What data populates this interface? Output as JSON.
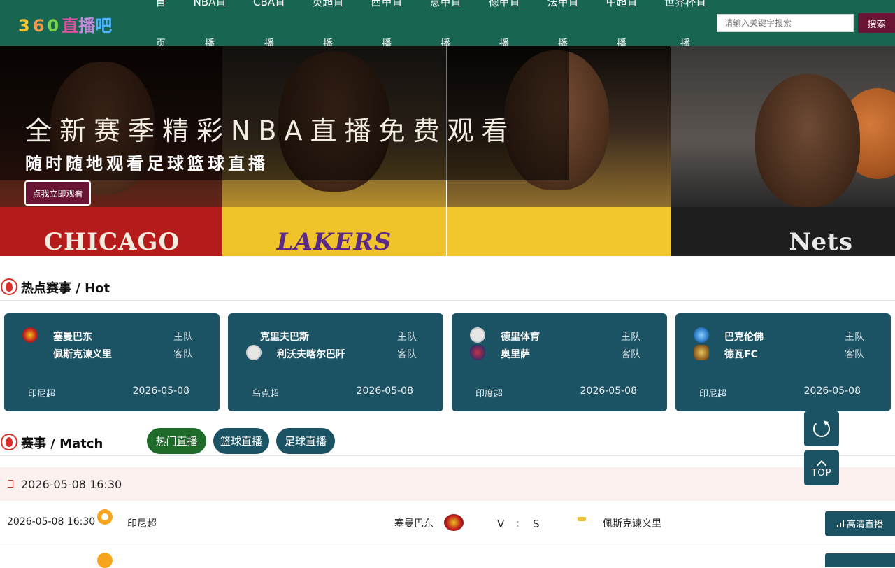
{
  "logo": {
    "text": "360 直播吧",
    "chars": [
      "3",
      "6",
      "0",
      "直",
      "播",
      "吧"
    ]
  },
  "nav": [
    {
      "top": "首",
      "bottom": "页"
    },
    {
      "top": "NBA直",
      "bottom": "播"
    },
    {
      "top": "CBA直",
      "bottom": "播"
    },
    {
      "top": "英超直",
      "bottom": "播"
    },
    {
      "top": "西甲直",
      "bottom": "播"
    },
    {
      "top": "意甲直",
      "bottom": "播"
    },
    {
      "top": "德甲直",
      "bottom": "播"
    },
    {
      "top": "法甲直",
      "bottom": "播"
    },
    {
      "top": "中超直",
      "bottom": "播"
    },
    {
      "top": "世界杯直",
      "bottom": "播"
    }
  ],
  "search": {
    "placeholder": "请输入关键字搜索",
    "button": "搜索"
  },
  "banner": {
    "title": "全新赛季精彩NBA直播免费观看",
    "subtitle": "随时随地观看足球篮球直播",
    "cta": "点我立即观看",
    "jersey_texts": [
      "CHICAGO",
      "LAKERS",
      "",
      "Nets"
    ]
  },
  "hot": {
    "title": "热点赛事 / Hot",
    "cards": [
      {
        "home": "塞曼巴东",
        "away": "佩斯克谏义里",
        "home_role": "主队",
        "away_role": "客队",
        "league": "印尼超",
        "date": "2026-05-08",
        "logo1_color": "#c21c1c",
        "logo2_color": ""
      },
      {
        "home": "克里夫巴斯",
        "away": "利沃夫喀尔巴阡",
        "home_role": "主队",
        "away_role": "客队",
        "league": "乌克超",
        "date": "2026-05-08",
        "logo1_color": "",
        "logo2_color": "#e9e9e9"
      },
      {
        "home": "德里体育",
        "away": "奥里萨",
        "home_role": "主队",
        "away_role": "客队",
        "league": "印度超",
        "date": "2026-05-08",
        "logo1_color": "#e9e9e9",
        "logo2_color": "#b3263d"
      },
      {
        "home": "巴克伦佛",
        "away": "德瓦FC",
        "home_role": "主队",
        "away_role": "客队",
        "league": "印尼超",
        "date": "2026-05-08",
        "logo1_color": "#2b8ad6",
        "logo2_color": "#caa030"
      }
    ]
  },
  "match": {
    "title": "赛事 / Match",
    "tabs": [
      "热门直播",
      "篮球直播",
      "足球直播"
    ],
    "date_header": "2026-05-08 16:30",
    "rows": [
      {
        "time": "2026-05-08 16:30",
        "league": "印尼超",
        "home": "塞曼巴东",
        "score_left": "V",
        "score_sep": ":",
        "score_right": "S",
        "away": "佩斯克谏义里",
        "button": "高清直播"
      }
    ]
  },
  "floating": {
    "top_label": "TOP"
  },
  "colors": {
    "header": "#186552",
    "card": "#1c5364",
    "accent": "#6a1435",
    "tab_active": "#1e6b2a",
    "hot_icon": "#d9302b"
  }
}
